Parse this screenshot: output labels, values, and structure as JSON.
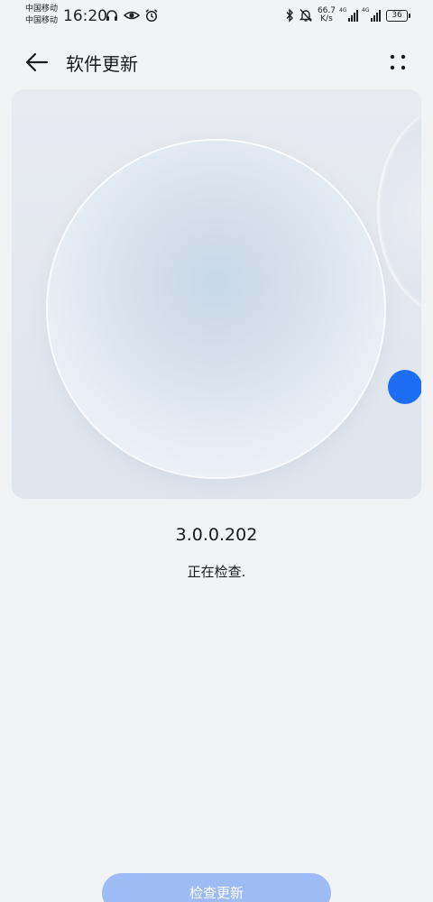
{
  "status_bar": {
    "carrier_1": "中国移动",
    "carrier_2": "中国移动",
    "time": "16:20",
    "net_speed_value": "66.7",
    "net_speed_unit": "K/s",
    "signal_1_tag": "4G",
    "signal_2_tag": "4G",
    "battery": "36",
    "icons": [
      "headphones-icon",
      "eye-icon",
      "alarm-icon",
      "bluetooth-icon",
      "mute-bell-icon",
      "signal-icon",
      "battery-icon"
    ]
  },
  "app_bar": {
    "title": "软件更新",
    "back_icon": "back-arrow-icon",
    "more_icon": "more-dots-icon"
  },
  "update": {
    "version": "3.0.0.202",
    "status": "正在检查."
  },
  "actions": {
    "check_update_label": "检查更新"
  },
  "colors": {
    "background": "#f1f3f5",
    "accent": "#1e6ef4",
    "button_disabled": "#9dbcf5"
  }
}
